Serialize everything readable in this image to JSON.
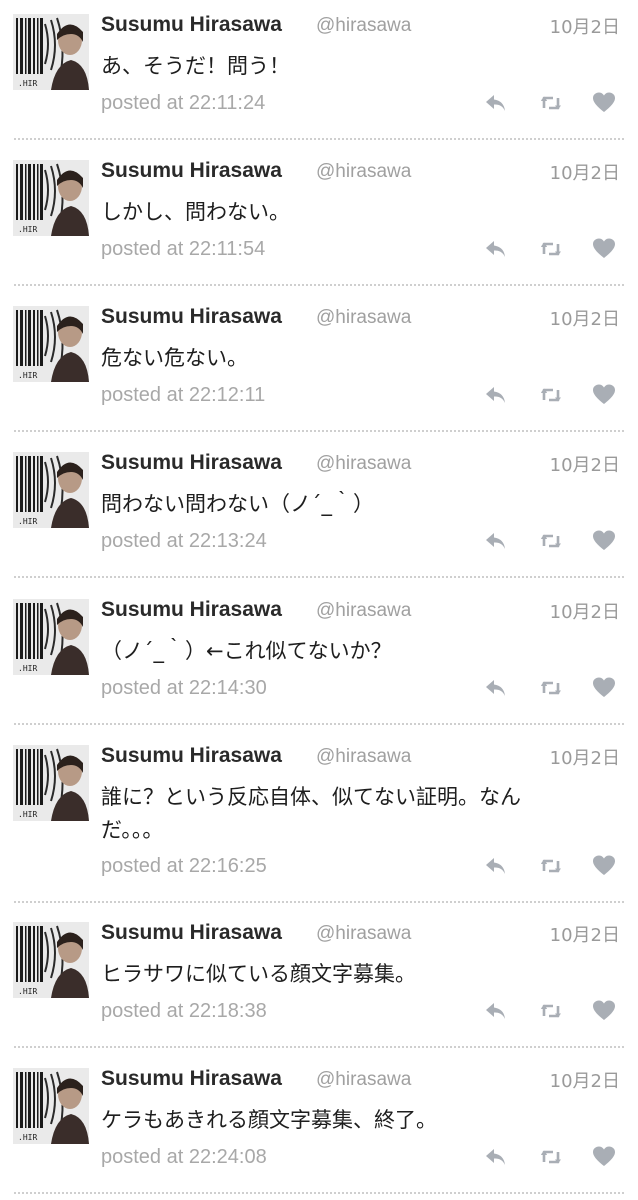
{
  "author": {
    "name": "Susumu Hirasawa",
    "handle": "@hirasawa"
  },
  "tweets": [
    {
      "date": "10月2日",
      "text": "あ、そうだ！問う！",
      "posted": "posted at 22:11:24"
    },
    {
      "date": "10月2日",
      "text": "しかし、問わない。",
      "posted": "posted at 22:11:54"
    },
    {
      "date": "10月2日",
      "text": "危ない危ない。",
      "posted": "posted at 22:12:11"
    },
    {
      "date": "10月2日",
      "text": "問わない問わない（ノ´_｀）",
      "posted": "posted at 22:13:24"
    },
    {
      "date": "10月2日",
      "text": "（ノ´_｀）←これ似てないか？",
      "posted": "posted at 22:14:30"
    },
    {
      "date": "10月2日",
      "text": "誰に？という反応自体、似てない証明。なんだ。。。",
      "posted": "posted at 22:16:25"
    },
    {
      "date": "10月2日",
      "text": "ヒラサワに似ている顔文字募集。",
      "posted": "posted at 22:18:38"
    },
    {
      "date": "10月2日",
      "text": "ケラもあきれる顔文字募集、終了。",
      "posted": "posted at 22:24:08"
    }
  ],
  "icons": {
    "reply": "reply-icon",
    "retweet": "retweet-icon",
    "like": "heart-icon"
  },
  "colors": {
    "icon": "#a9aeb5",
    "name": "#2a2a2a",
    "muted": "#a0a0a0",
    "divider": "#cfcfcf"
  }
}
